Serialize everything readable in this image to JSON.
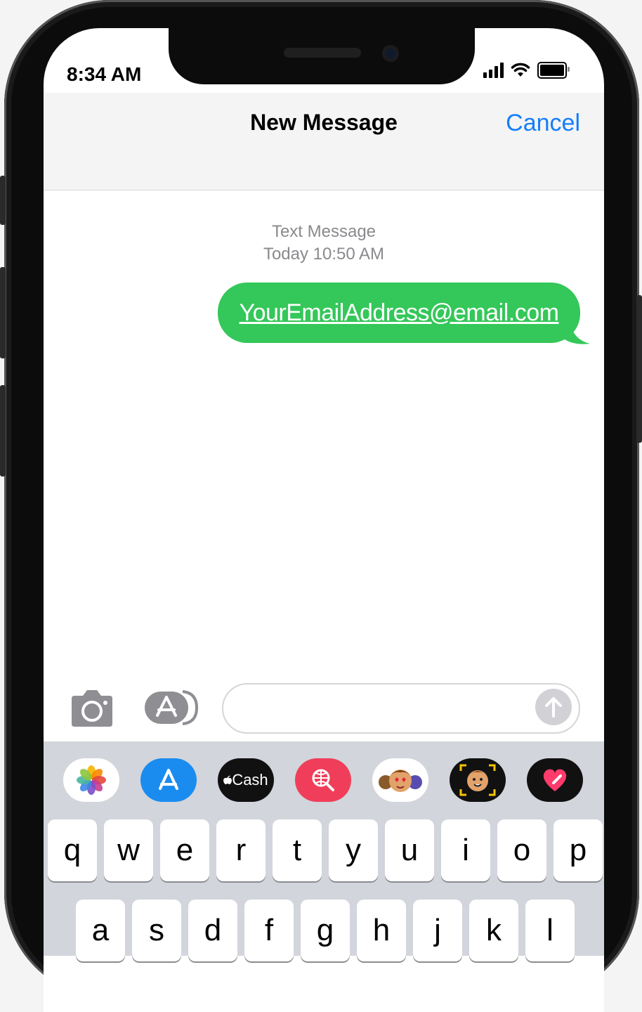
{
  "status_bar": {
    "time": "8:34 AM"
  },
  "header": {
    "title": "New Message",
    "cancel_label": "Cancel"
  },
  "conversation": {
    "service_label": "Text Message",
    "timestamp": "Today 10:50 AM",
    "messages": [
      {
        "text": "YourEmailAddress@email.com",
        "sender": "me"
      }
    ]
  },
  "input": {
    "placeholder": ""
  },
  "app_strip": {
    "items": [
      {
        "name": "photos"
      },
      {
        "name": "app-store"
      },
      {
        "name": "apple-cash",
        "label": "Cash"
      },
      {
        "name": "images-search"
      },
      {
        "name": "memoji-stickers"
      },
      {
        "name": "animoji"
      },
      {
        "name": "digital-touch"
      }
    ]
  },
  "keyboard": {
    "row1": [
      "q",
      "w",
      "e",
      "r",
      "t",
      "y",
      "u",
      "i",
      "o",
      "p"
    ],
    "row2": [
      "a",
      "s",
      "d",
      "f",
      "g",
      "h",
      "j",
      "k",
      "l"
    ]
  },
  "colors": {
    "accent": "#147efb",
    "bubble": "#34c759"
  }
}
